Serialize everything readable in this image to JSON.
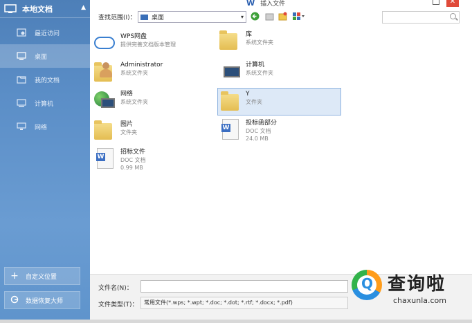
{
  "sidebar": {
    "title": "本地文档",
    "collapse": "▲",
    "items": [
      {
        "label": "最近访问",
        "icon": "recent-icon"
      },
      {
        "label": "桌面",
        "icon": "desktop-icon"
      },
      {
        "label": "我的文档",
        "icon": "documents-icon"
      },
      {
        "label": "计算机",
        "icon": "computer-icon"
      },
      {
        "label": "网络",
        "icon": "network-icon"
      }
    ],
    "active_index": 1,
    "custom_location": "自定义位置",
    "data_recovery": "数据恢复大师"
  },
  "window": {
    "title": "插入文件",
    "logo": "W",
    "close": "✕"
  },
  "toolbar": {
    "lookin_label": "查找范围(I)：",
    "lookin_value": "桌面",
    "dropdown": "▾",
    "icons": [
      "back-icon",
      "up-folder-icon",
      "new-folder-icon",
      "view-menu-icon"
    ],
    "search_placeholder": ""
  },
  "files": [
    {
      "name": "WPS网盘",
      "sub1": "提供完善文档版本管理",
      "sub2": "",
      "icon": "cloud-icon"
    },
    {
      "name": "库",
      "sub1": "系统文件夹",
      "sub2": "",
      "icon": "library-folder-icon"
    },
    {
      "name": "Administrator",
      "sub1": "系统文件夹",
      "sub2": "",
      "icon": "user-folder-icon"
    },
    {
      "name": "计算机",
      "sub1": "系统文件夹",
      "sub2": "",
      "icon": "computer-icon"
    },
    {
      "name": "网络",
      "sub1": "系统文件夹",
      "sub2": "",
      "icon": "network-icon"
    },
    {
      "name": "Y",
      "sub1": "文件夹",
      "sub2": "",
      "icon": "folder-icon"
    },
    {
      "name": "图片",
      "sub1": "文件夹",
      "sub2": "",
      "icon": "folder-icon"
    },
    {
      "name": "投标函部分",
      "sub1": "DOC 文档",
      "sub2": "24.0 MB",
      "icon": "doc-icon"
    },
    {
      "name": "招标文件",
      "sub1": "DOC 文档",
      "sub2": "0.99 MB",
      "icon": "doc-icon"
    }
  ],
  "selected_file_index": 5,
  "bottom": {
    "filename_label": "文件名(N)：",
    "filename_value": "",
    "filetype_label": "文件类型(T)：",
    "filetype_value": "常用文件(*.wps; *.wpt; *.doc; *.dot; *.rtf; *.docx; *.pdf)"
  },
  "watermark": {
    "cn": "查询啦",
    "en": "chaxunla.com",
    "q": "Q"
  },
  "colors": {
    "sidebar_top": "#4d7fb8",
    "sidebar_bottom": "#5f94cc",
    "selection": "#dde9f7",
    "close_button": "#e04a3a"
  }
}
